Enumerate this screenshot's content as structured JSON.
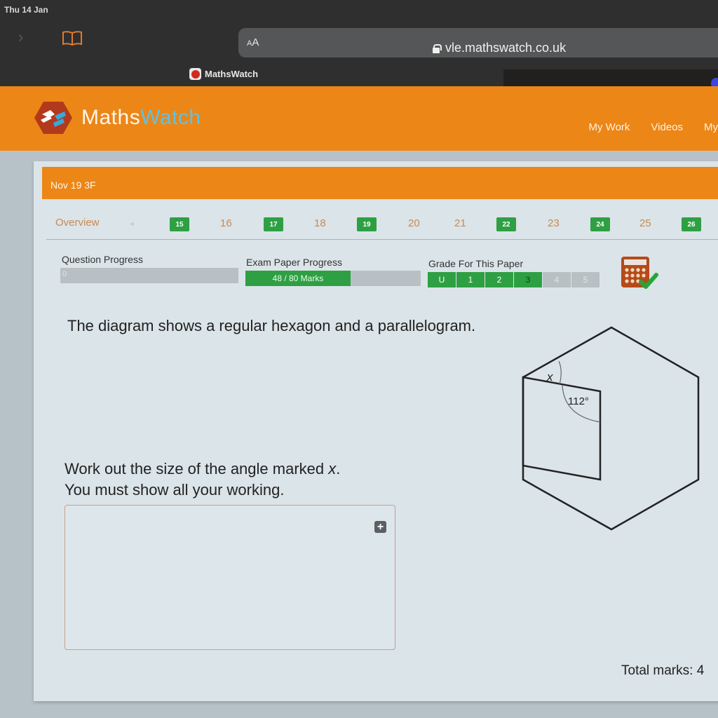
{
  "status_bar": {
    "date": "Thu 14 Jan"
  },
  "browser": {
    "forward_icon": "chevron-right-icon",
    "bookmarks_icon": "book-icon",
    "reader_label_small": "A",
    "reader_label_large": "A",
    "url": "vle.mathswatch.co.uk",
    "lock_icon": "lock-icon",
    "tabs": [
      {
        "title": "MathsWatch",
        "active": true
      }
    ]
  },
  "header": {
    "logo_text_main": "Maths",
    "logo_text_accent": "Watch",
    "brand_color": "#ec8617",
    "accent_color": "#5ec2e6",
    "nav": [
      "My Work",
      "Videos",
      "My"
    ]
  },
  "paper": {
    "title": "Nov 19 3F",
    "overview_label": "Overview",
    "prev_label": "«",
    "questions": [
      {
        "number": "15",
        "completed": true
      },
      {
        "number": "16",
        "completed": false
      },
      {
        "number": "17",
        "completed": true
      },
      {
        "number": "18",
        "completed": false
      },
      {
        "number": "19",
        "completed": true
      },
      {
        "number": "20",
        "completed": false
      },
      {
        "number": "21",
        "completed": false
      },
      {
        "number": "22",
        "completed": true
      },
      {
        "number": "23",
        "completed": false
      },
      {
        "number": "24",
        "completed": true
      },
      {
        "number": "25",
        "completed": false
      },
      {
        "number": "26",
        "completed": true
      }
    ],
    "completed_color": "#2ea043"
  },
  "progress": {
    "question_label": "Question Progress",
    "question_value": "0",
    "question_fraction": 0,
    "exam_label": "Exam Paper Progress",
    "exam_marks_text": "48 / 80 Marks",
    "exam_marks": 48,
    "exam_total": 80,
    "grade_label": "Grade For This Paper",
    "grades": [
      "U",
      "1",
      "2",
      "3",
      "4",
      "5"
    ],
    "current_grade": "3",
    "calculator_icon": "calculator-allowed-icon"
  },
  "question": {
    "text": "The diagram shows a regular hexagon and a parallelogram.",
    "instruction_line1_a": "Work out the size of the angle marked ",
    "instruction_var": "x",
    "instruction_line1_b": ".",
    "instruction_line2": "You must show all your working.",
    "diagram": {
      "angle_label_x": "x",
      "angle_label_given": "112°"
    },
    "answer_placeholder": "",
    "expand_icon": "plus-icon",
    "total_marks": "Total marks: 4"
  }
}
